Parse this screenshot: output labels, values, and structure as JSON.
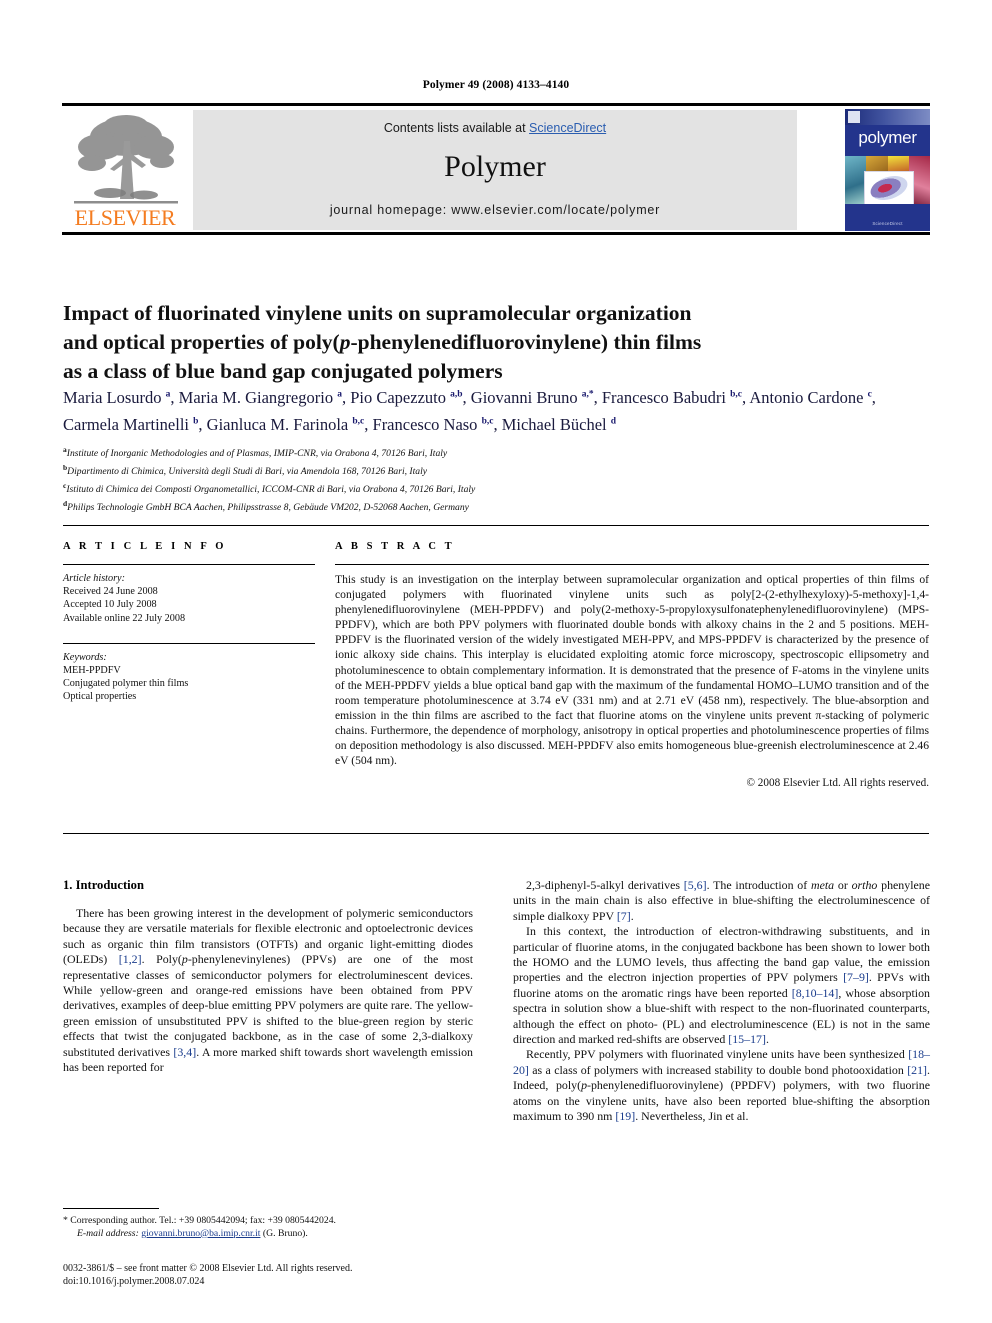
{
  "running_head": "Polymer 49 (2008) 4133–4140",
  "masthead": {
    "contents_prefix": "Contents lists available at ",
    "sciencedirect": "ScienceDirect",
    "journal_title": "Polymer",
    "homepage": "journal homepage: www.elsevier.com/locate/polymer",
    "publisher_wordmark": "ELSEVIER",
    "cover_wordmark": "polymer",
    "cover_footer": "ScienceDirect",
    "accent_orange": "#f47c20",
    "link_blue": "#2a5db0",
    "panel_grey": "#e3e3e3",
    "cover_blue": "#23348c"
  },
  "title": {
    "line1": "Impact of fluorinated vinylene units on supramolecular organization",
    "line2_a": "and optical properties of poly(",
    "line2_i": "p",
    "line2_b": "-phenylenedifluorovinylene) thin films",
    "line3": "as a class of blue band gap conjugated polymers"
  },
  "authors": [
    {
      "name": "Maria Losurdo",
      "sup": "a",
      "sep": ", "
    },
    {
      "name": "Maria M. Giangregorio",
      "sup": "a",
      "sep": ", "
    },
    {
      "name": "Pio Capezzuto",
      "sup": "a,b",
      "sep": ", "
    },
    {
      "name": "Giovanni Bruno",
      "sup": "a,*",
      "sep": ", "
    },
    {
      "name": "Francesco Babudri",
      "sup": "b,c",
      "sep": ", "
    },
    {
      "name": "Antonio Cardone",
      "sup": "c",
      "sep": ", "
    },
    {
      "name": "Carmela Martinelli",
      "sup": "b",
      "sep": ", "
    },
    {
      "name": "Gianluca M. Farinola",
      "sup": "b,c",
      "sep": ", "
    },
    {
      "name": "Francesco Naso",
      "sup": "b,c",
      "sep": ", "
    },
    {
      "name": "Michael Büchel",
      "sup": "d",
      "sep": ""
    }
  ],
  "affiliations": [
    {
      "mark": "a",
      "text": "Institute of Inorganic Methodologies and of Plasmas, IMIP-CNR, via Orabona 4, 70126 Bari, Italy"
    },
    {
      "mark": "b",
      "text": "Dipartimento di Chimica, Università degli Studi di Bari, via Amendola 168, 70126 Bari, Italy"
    },
    {
      "mark": "c",
      "text": "Istituto di Chimica dei Composti Organometallici, ICCOM-CNR di Bari, via Orabona 4, 70126 Bari, Italy"
    },
    {
      "mark": "d",
      "text": "Philips Technologie GmbH BCA Aachen, Philipsstrasse 8, Gebäude VM202, D-52068 Aachen, Germany"
    }
  ],
  "article_info": {
    "heading": "A R T I C L E   I N F O",
    "history_label": "Article history:",
    "history": [
      "Received 24 June 2008",
      "Accepted 10 July 2008",
      "Available online 22 July 2008"
    ],
    "keywords_label": "Keywords:",
    "keywords": [
      "MEH-PPDFV",
      "Conjugated polymer thin films",
      "Optical properties"
    ]
  },
  "abstract": {
    "heading": "A B S T R A C T",
    "text": "This study is an investigation on the interplay between supramolecular organization and optical properties of thin films of conjugated polymers with fluorinated vinylene units such as poly[2-(2-ethylhexyloxy)-5-methoxy]-1,4-phenylenedifluorovinylene (MEH-PPDFV) and poly(2-methoxy-5-propyloxysulfonatephenylenedifluorovinylene) (MPS-PPDFV), which are both PPV polymers with fluorinated double bonds with alkoxy chains in the 2 and 5 positions. MEH-PPDFV is the fluorinated version of the widely investigated MEH-PPV, and MPS-PPDFV is characterized by the presence of ionic alkoxy side chains. This interplay is elucidated exploiting atomic force microscopy, spectroscopic ellipsometry and photoluminescence to obtain complementary information. It is demonstrated that the presence of F-atoms in the vinylene units of the MEH-PPDFV yields a blue optical band gap with the maximum of the fundamental HOMO–LUMO transition and of the room temperature photoluminescence at 3.74 eV (331 nm) and at 2.71 eV (458 nm), respectively. The blue-absorption and emission in the thin films are ascribed to the fact that fluorine atoms on the vinylene units prevent π-stacking of polymeric chains. Furthermore, the dependence of morphology, anisotropy in optical properties and photoluminescence properties of films on deposition methodology is also discussed. MEH-PPDFV also emits homogeneous blue-greenish electroluminescence at 2.46 eV (504 nm).",
    "copyright": "© 2008 Elsevier Ltd. All rights reserved."
  },
  "body": {
    "section_title": "1.  Introduction",
    "left_paragraphs": [
      "There has been growing interest in the development of polymeric semiconductors because they are versatile materials for flexible electronic and optoelectronic devices such as organic thin film transistors (OTFTs) and organic light-emitting diodes (OLEDs) [1,2]. Poly(p-phenylenevinylenes) (PPVs) are one of the most representative classes of semiconductor polymers for electroluminescent devices. While yellow-green and orange-red emissions have been obtained from PPV derivatives, examples of deep-blue emitting PPV polymers are quite rare. The yellow-green emission of unsubstituted PPV is shifted to the blue-green region by steric effects that twist the conjugated backbone, as in the case of some 2,3-dialkoxy substituted derivatives [3,4]. A more marked shift towards short wavelength emission has been reported for"
    ],
    "right_paragraphs": [
      "2,3-diphenyl-5-alkyl derivatives [5,6]. The introduction of meta or ortho phenylene units in the main chain is also effective in blue-shifting the electroluminescence of simple dialkoxy PPV [7].",
      "In this context, the introduction of electron-withdrawing substituents, and in particular of fluorine atoms, in the conjugated backbone has been shown to lower both the HOMO and the LUMO levels, thus affecting the band gap value, the emission properties and the electron injection properties of PPV polymers [7–9]. PPVs with fluorine atoms on the aromatic rings have been reported [8,10–14], whose absorption spectra in solution show a blue-shift with respect to the non-fluorinated counterparts, although the effect on photo- (PL) and electroluminescence (EL) is not in the same direction and marked red-shifts are observed [15–17].",
      "Recently, PPV polymers with fluorinated vinylene units have been synthesized [18–20] as a class of polymers with increased stability to double bond photooxidation [21]. Indeed, poly(p-phenylenedifluorovinylene) (PPDFV) polymers, with two fluorine atoms on the vinylene units, have also been reported blue-shifting the absorption maximum to 390 nm [19]. Nevertheless, Jin et al."
    ]
  },
  "footnote": {
    "corresponding": "* Corresponding author. Tel.: +39 0805442094; fax: +39 0805442024.",
    "email_label": "E-mail address:",
    "email": "giovanni.bruno@ba.imip.cnr.it",
    "email_owner": "(G. Bruno)."
  },
  "copyright_block": {
    "line1": "0032-3861/$ – see front matter © 2008 Elsevier Ltd. All rights reserved.",
    "line2": "doi:10.1016/j.polymer.2008.07.024"
  }
}
